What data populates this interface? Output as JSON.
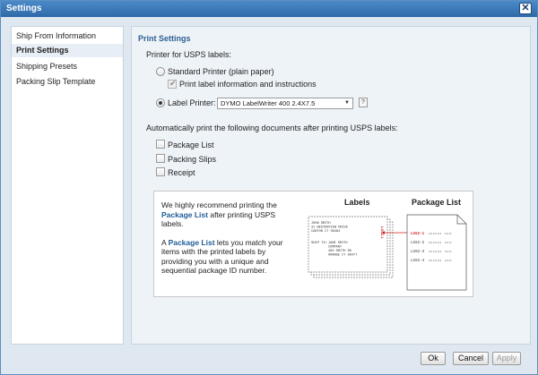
{
  "window": {
    "title": "Settings",
    "close_label": "✕"
  },
  "sidebar": {
    "items": [
      {
        "label": "Ship From Information",
        "active": false
      },
      {
        "label": "Print Settings",
        "active": true
      },
      {
        "label": "Shipping Presets",
        "active": false
      },
      {
        "label": "Packing Slip Template",
        "active": false
      }
    ]
  },
  "panel": {
    "title": "Print Settings",
    "printer_for_label": "Printer for USPS labels:",
    "standard_printer_label": "Standard Printer (plain paper)",
    "print_info_label": "Print label information and instructions",
    "label_printer_label": "Label Printer:",
    "label_printer_value": "DYMO LabelWriter 400 2.4X7.5",
    "help_label": "?",
    "auto_print_label": "Automatically print the following documents after printing USPS labels:",
    "checks": [
      {
        "label": "Package List",
        "checked": false
      },
      {
        "label": "Packing Slips",
        "checked": false
      },
      {
        "label": "Receipt",
        "checked": false
      }
    ]
  },
  "info": {
    "p1_pre": "We highly recommend printing the ",
    "p1_link": "Package List",
    "p1_post": " after printing USPS labels.",
    "p2_pre": "A ",
    "p2_link": "Package List",
    "p2_post": " lets you match your items with the printed labels by providing you with a unique and sequential package ID number.",
    "labels_heading": "Labels",
    "package_list_heading": "Package List",
    "label_lines": [
      "JOHN SMITH",
      "31 WESTERVIEW DRIVE",
      "CANTON CT 06484"
    ],
    "ship_to_label": "SHIP TO:",
    "ship_to_lines": [
      "JANE SMITH",
      "COMPANY",
      "400 SMITH RD",
      "ORANGE CT 06477"
    ],
    "tag_id": "LSS2-1",
    "list_rows": [
      "LSS2-1",
      "LSS2-2",
      "LSS2-3",
      "LSS2-4"
    ]
  },
  "footer": {
    "ok_label": "Ok",
    "cancel_label": "Cancel",
    "apply_label": "Apply"
  },
  "colors": {
    "accent": "#2f5f93",
    "link": "#1f5c98",
    "tag": "#cc2222",
    "titlebar": "#3c78b8"
  }
}
